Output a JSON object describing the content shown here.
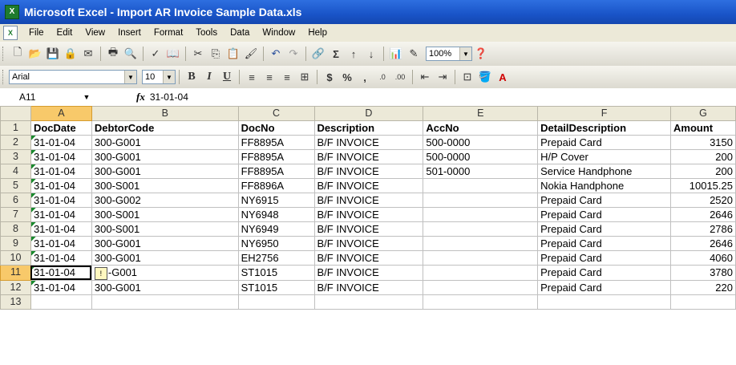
{
  "window": {
    "title": "Microsoft Excel - Import AR Invoice Sample Data.xls"
  },
  "menu": [
    "File",
    "Edit",
    "View",
    "Insert",
    "Format",
    "Tools",
    "Data",
    "Window",
    "Help"
  ],
  "toolbar": {
    "zoom": "100%",
    "font": "Arial",
    "size": "10"
  },
  "formula_bar": {
    "cell_ref": "A11",
    "value": "31-01-04"
  },
  "columns": [
    "A",
    "B",
    "C",
    "D",
    "E",
    "F",
    "G"
  ],
  "header_row": [
    "DocDate",
    "DebtorCode",
    "DocNo",
    "Description",
    "AccNo",
    "DetailDescription",
    "Amount"
  ],
  "rows": [
    [
      "31-01-04",
      "300-G001",
      "FF8895A",
      "B/F INVOICE",
      "500-0000",
      "Prepaid Card",
      "3150"
    ],
    [
      "31-01-04",
      "300-G001",
      "FF8895A",
      "B/F INVOICE",
      "500-0000",
      "H/P Cover",
      "200"
    ],
    [
      "31-01-04",
      "300-G001",
      "FF8895A",
      "B/F INVOICE",
      "501-0000",
      "Service Handphone",
      "200"
    ],
    [
      "31-01-04",
      "300-S001",
      "FF8896A",
      "B/F INVOICE",
      "",
      "Nokia Handphone",
      "10015.25"
    ],
    [
      "31-01-04",
      "300-G002",
      "NY6915",
      "B/F INVOICE",
      "",
      "Prepaid Card",
      "2520"
    ],
    [
      "31-01-04",
      "300-S001",
      "NY6948",
      "B/F INVOICE",
      "",
      "Prepaid Card",
      "2646"
    ],
    [
      "31-01-04",
      "300-S001",
      "NY6949",
      "B/F INVOICE",
      "",
      "Prepaid Card",
      "2786"
    ],
    [
      "31-01-04",
      "300-G001",
      "NY6950",
      "B/F INVOICE",
      "",
      "Prepaid Card",
      "2646"
    ],
    [
      "31-01-04",
      "300-G001",
      "EH2756",
      "B/F INVOICE",
      "",
      "Prepaid Card",
      "4060"
    ],
    [
      "31-01-04",
      "-G001",
      "ST1015",
      "B/F INVOICE",
      "",
      "Prepaid Card",
      "3780"
    ],
    [
      "31-01-04",
      "300-G001",
      "ST1015",
      "B/F INVOICE",
      "",
      "Prepaid Card",
      "220"
    ]
  ],
  "row_numbers": [
    "1",
    "2",
    "3",
    "4",
    "5",
    "6",
    "7",
    "8",
    "9",
    "10",
    "11",
    "12",
    "13"
  ]
}
